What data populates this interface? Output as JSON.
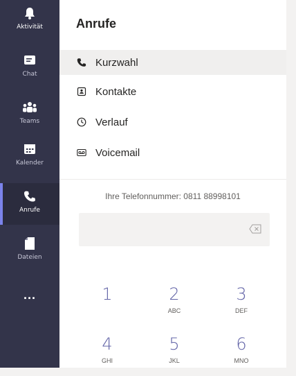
{
  "rail": {
    "items": [
      {
        "label": "Aktivität",
        "icon": "bell-icon"
      },
      {
        "label": "Chat",
        "icon": "chat-icon"
      },
      {
        "label": "Teams",
        "icon": "teams-icon"
      },
      {
        "label": "Kalender",
        "icon": "calendar-icon"
      },
      {
        "label": "Anrufe",
        "icon": "phone-icon",
        "active": true
      },
      {
        "label": "Dateien",
        "icon": "files-icon"
      },
      {
        "label": "...",
        "icon": "more-icon"
      }
    ]
  },
  "panel": {
    "title": "Anrufe",
    "nav": [
      {
        "label": "Kurzwahl",
        "icon": "phone-icon",
        "selected": true
      },
      {
        "label": "Kontakte",
        "icon": "contacts-icon"
      },
      {
        "label": "Verlauf",
        "icon": "history-icon"
      },
      {
        "label": "Voicemail",
        "icon": "voicemail-icon"
      }
    ],
    "phone_number_text": "Ihre Telefonnummer: 0811 88998101"
  },
  "dialpad": {
    "keys": [
      {
        "num": "1",
        "letters": ""
      },
      {
        "num": "2",
        "letters": "ABC"
      },
      {
        "num": "3",
        "letters": "DEF"
      },
      {
        "num": "4",
        "letters": "GHI"
      },
      {
        "num": "5",
        "letters": "JKL"
      },
      {
        "num": "6",
        "letters": "MNO"
      }
    ]
  },
  "colors": {
    "rail_bg": "#33344a",
    "accent": "#6264a7"
  }
}
